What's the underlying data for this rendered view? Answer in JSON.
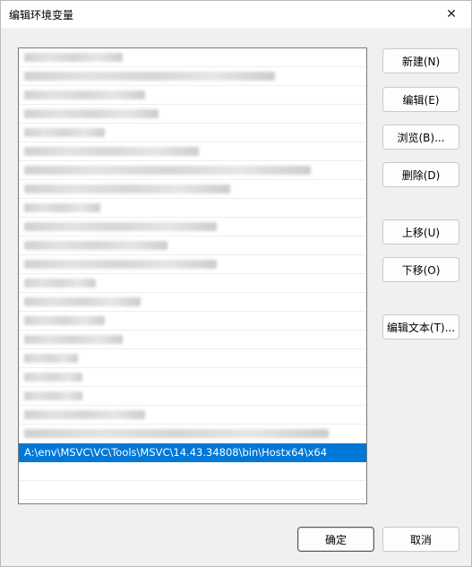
{
  "window": {
    "title": "编辑环境变量",
    "close_glyph": "✕"
  },
  "list": {
    "blurred_rows": 21,
    "selected_value": "A:\\env\\MSVC\\VC\\Tools\\MSVC\\14.43.34808\\bin\\Hostx64\\x64"
  },
  "buttons": {
    "new": "新建(N)",
    "edit": "编辑(E)",
    "browse": "浏览(B)...",
    "delete": "删除(D)",
    "move_up": "上移(U)",
    "move_down": "下移(O)",
    "edit_text": "编辑文本(T)...",
    "ok": "确定",
    "cancel": "取消"
  }
}
